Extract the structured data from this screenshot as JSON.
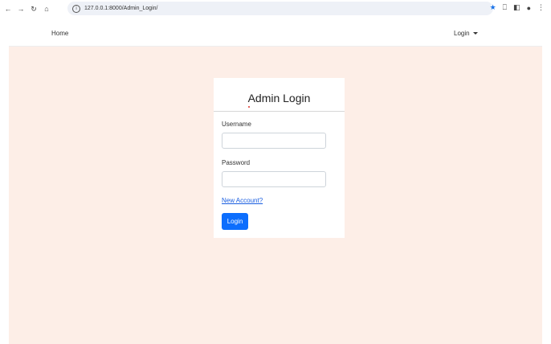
{
  "browser": {
    "url": "127.0.0.1:8000/Admin_Login/"
  },
  "navbar": {
    "home_label": "Home",
    "login_label": "Login"
  },
  "login_card": {
    "title": "Admin Login",
    "username_label": "Username",
    "username_value": "",
    "password_label": "Password",
    "password_value": "",
    "new_account_link": "New Account?",
    "login_button": "Login"
  },
  "colors": {
    "page_background": "#fdeee7",
    "primary_button": "#0d6efd",
    "link": "#1a5ee0"
  }
}
